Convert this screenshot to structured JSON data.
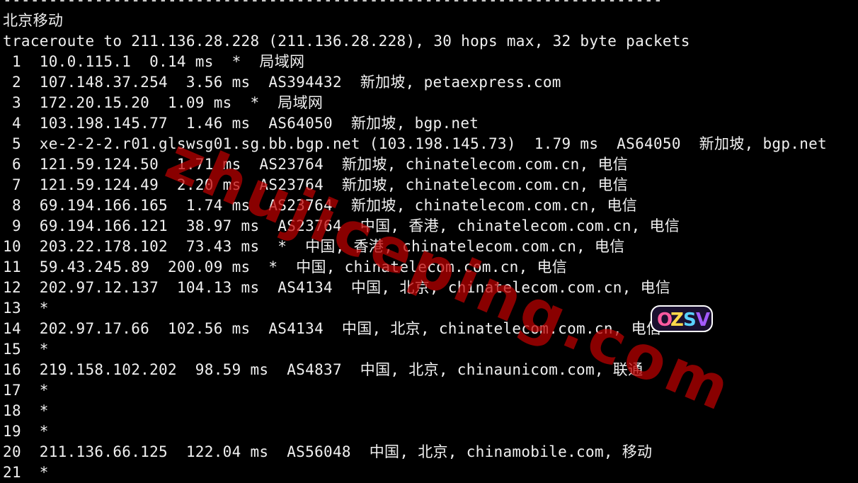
{
  "terminal": {
    "lines": [
      "------------------------------------------------------------------------",
      "北京移动",
      "traceroute to 211.136.28.228 (211.136.28.228), 30 hops max, 32 byte packets",
      " 1  10.0.115.1  0.14 ms  *  局域网",
      " 2  107.148.37.254  3.56 ms  AS394432  新加坡, petaexpress.com",
      " 3  172.20.15.20  1.09 ms  *  局域网",
      " 4  103.198.145.77  1.46 ms  AS64050  新加坡, bgp.net",
      " 5  xe-2-2-2.r01.glswsg01.sg.bb.bgp.net (103.198.145.73)  1.79 ms  AS64050  新加坡, bgp.net",
      " 6  121.59.124.50  1.71 ms  AS23764  新加坡, chinatelecom.com.cn, 电信",
      " 7  121.59.124.49  2.20 ms  AS23764  新加坡, chinatelecom.com.cn, 电信",
      " 8  69.194.166.165  1.74 ms  AS23764  新加坡, chinatelecom.com.cn, 电信",
      " 9  69.194.166.121  38.97 ms  AS23764  中国, 香港, chinatelecom.com.cn, 电信",
      "10  203.22.178.102  73.43 ms  *  中国, 香港, chinatelecom.com.cn, 电信",
      "11  59.43.245.89  200.09 ms  *  中国, chinatelecom.com.cn, 电信",
      "12  202.97.12.137  104.13 ms  AS4134  中国, 北京, chinatelecom.com.cn, 电信",
      "13  *",
      "14  202.97.17.66  102.56 ms  AS4134  中国, 北京, chinatelecom.com.cn, 电信",
      "15  *",
      "16  219.158.102.202  98.59 ms  AS4837  中国, 北京, chinaunicom.com, 联通",
      "17  *",
      "18  *",
      "19  *",
      "20  211.136.66.125  122.04 ms  AS56048  中国, 北京, chinamobile.com, 移动",
      "21  *"
    ]
  },
  "watermark": {
    "text": "zhujiceping.com",
    "color": "#be0000"
  },
  "logo": {
    "text": "OZSV",
    "colors": [
      "#ff5aa0",
      "#ffd84a",
      "#5ad2ff",
      "#a45aff"
    ]
  },
  "colors": {
    "background": "#000000",
    "foreground": "#f0f0f0"
  }
}
